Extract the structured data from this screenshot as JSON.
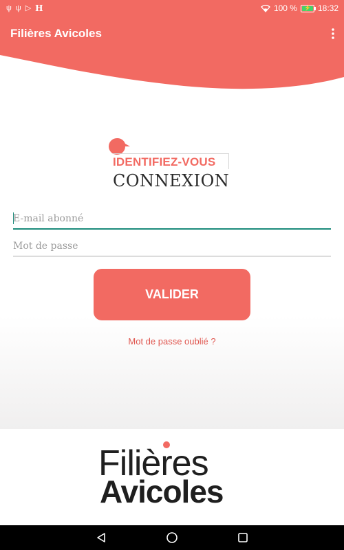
{
  "status_bar": {
    "left_icons": [
      "usb-icon",
      "usb-icon",
      "play-store-icon",
      "h-icon"
    ],
    "h_label": "H",
    "battery_percent": "100 %",
    "time": "18:32"
  },
  "app_bar": {
    "title": "Filières Avicoles",
    "menu_icon": "more-vert-icon"
  },
  "login": {
    "heading": "IDENTIFIEZ-VOUS",
    "subheading": "CONNEXION",
    "email_placeholder": "E-mail abonné",
    "email_value": "",
    "password_placeholder": "Mot de passe",
    "password_value": "",
    "submit_label": "VALIDER",
    "forgot_label": "Mot de passe oublié ?"
  },
  "brand": {
    "line1": "Filières",
    "line2": "Avicoles"
  },
  "colors": {
    "accent": "#f26a62",
    "input_focus": "#1a8a7a"
  },
  "nav": [
    "back-icon",
    "home-icon",
    "recents-icon"
  ]
}
